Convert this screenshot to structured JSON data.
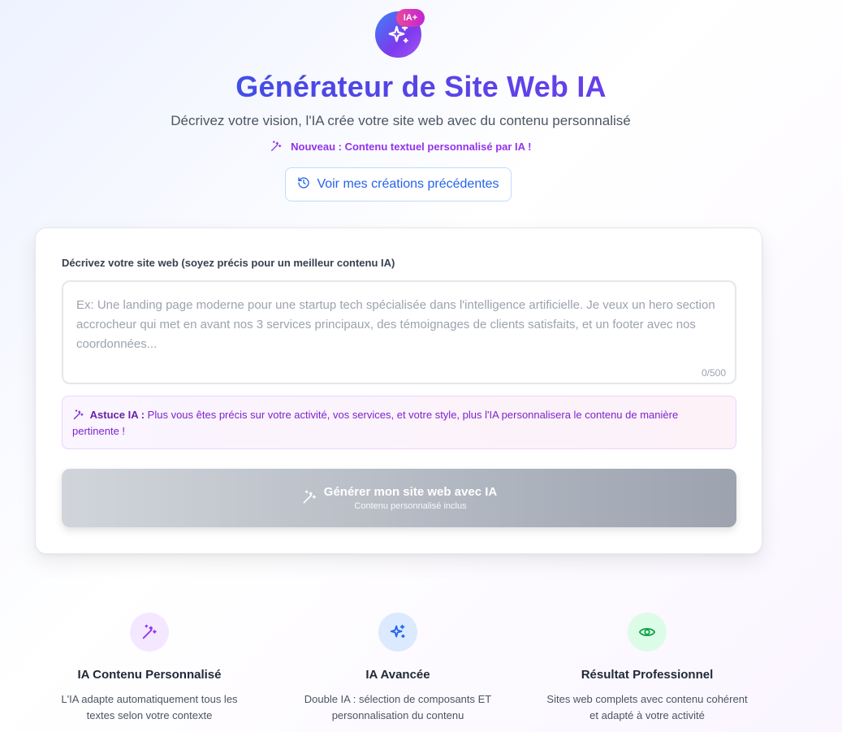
{
  "header": {
    "logo_badge": "IA+",
    "title": "Générateur de Site Web IA",
    "subtitle": "Décrivez votre vision, l'IA crée votre site web avec du contenu personnalisé",
    "new_badge": "Nouveau : Contenu textuel personnalisé par IA !",
    "history_button": "Voir mes créations précédentes"
  },
  "form": {
    "label": "Décrivez votre site web (soyez précis pour un meilleur contenu IA)",
    "placeholder": "Ex: Une landing page moderne pour une startup tech spécialisée dans l'intelligence artificielle. Je veux un hero section accrocheur qui met en avant nos 3 services principaux, des témoignages de clients satisfaits, et un footer avec nos coordonnées...",
    "value": "",
    "char_count": "0/500",
    "tip_label": "Astuce IA :",
    "tip_text": "Plus vous êtes précis sur votre activité, vos services, et votre style, plus l'IA personnalisera le contenu de manière pertinente !",
    "generate_label": "Générer mon site web avec IA",
    "generate_sublabel": "Contenu personnalisé inclus"
  },
  "features": [
    {
      "icon": "magic-wand-icon",
      "title": "IA Contenu Personnalisé",
      "description": "L'IA adapte automatiquement tous les textes selon votre contexte",
      "color": "#9333ea"
    },
    {
      "icon": "sparkles-icon",
      "title": "IA Avancée",
      "description": "Double IA : sélection de composants ET personnalisation du contenu",
      "color": "#2563eb"
    },
    {
      "icon": "eye-icon",
      "title": "Résultat Professionnel",
      "description": "Sites web complets avec contenu cohérent et adapté à votre activité",
      "color": "#16a34a"
    }
  ],
  "colors": {
    "primary": "#2563eb",
    "accent": "#7c3aed",
    "pink": "#ec4899"
  }
}
